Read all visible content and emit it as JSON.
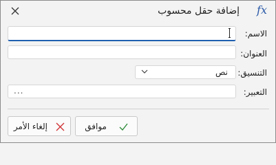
{
  "dialog": {
    "title": "إضافة حقل محسوب",
    "title_icon": "fx-icon",
    "title_icon_text": "fx",
    "close_icon": "close-icon"
  },
  "fields": {
    "name_label": "الاسم:",
    "name_value": "",
    "address_label": "العنوان:",
    "address_value": "",
    "format_label": "التنسيق:",
    "format_value": "نص",
    "expression_label": "التعبير:",
    "expression_value": "..."
  },
  "buttons": {
    "ok_label": "موافق",
    "ok_icon": "check-icon",
    "cancel_label": "إلغاء الأمر",
    "cancel_icon": "x-icon"
  },
  "colors": {
    "accent": "#1f5fb0",
    "ok_green": "#2e8b3a",
    "cancel_red": "#d13438",
    "fx_blue": "#2b5aa8"
  }
}
